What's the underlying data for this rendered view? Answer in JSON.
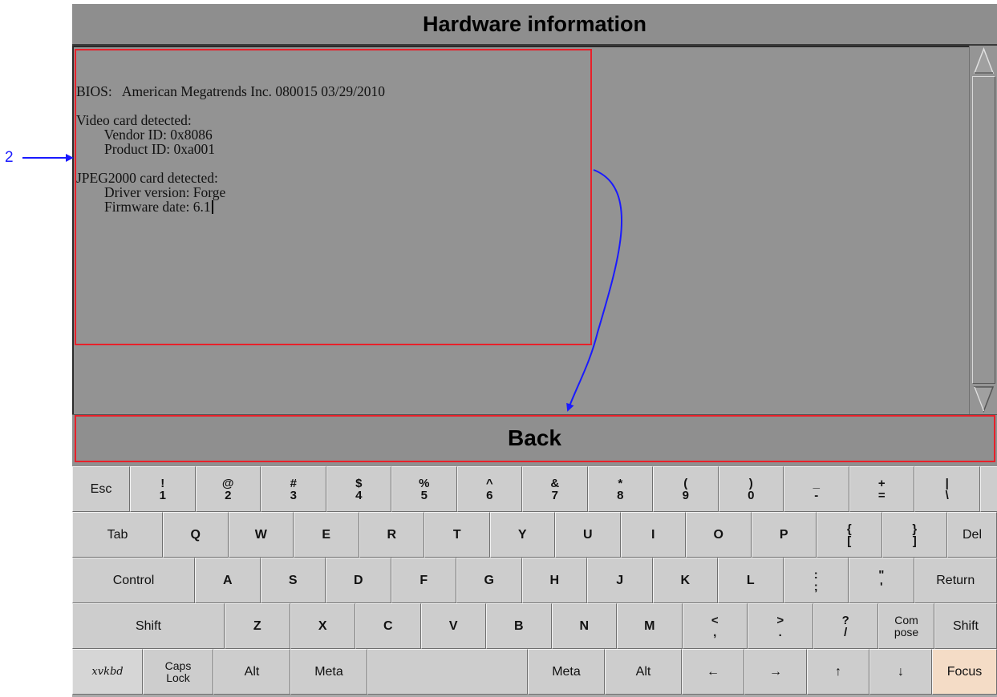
{
  "window": {
    "title": "Hardware information",
    "back_label": "Back"
  },
  "info_lines": [
    "BIOS:   American Megatrends Inc. 080015 03/29/2010",
    "",
    "Video card detected:",
    "        Vendor ID: 0x8086",
    "        Product ID: 0xa001",
    "",
    "JPEG2000 card detected:",
    "        Driver version: Forge",
    "        Firmware date: 6.1"
  ],
  "annotation": {
    "callout_number": "2",
    "highlight_color": "#e8202a",
    "arrow_color": "#1a1aff"
  },
  "keyboard": {
    "logo": "xvkbd",
    "row1": {
      "esc": "Esc",
      "keys": [
        {
          "top": "!",
          "bottom": "1"
        },
        {
          "top": "@",
          "bottom": "2"
        },
        {
          "top": "#",
          "bottom": "3"
        },
        {
          "top": "$",
          "bottom": "4"
        },
        {
          "top": "%",
          "bottom": "5"
        },
        {
          "top": "^",
          "bottom": "6"
        },
        {
          "top": "&",
          "bottom": "7"
        },
        {
          "top": "*",
          "bottom": "8"
        },
        {
          "top": "(",
          "bottom": "9"
        },
        {
          "top": ")",
          "bottom": "0"
        },
        {
          "top": "_",
          "bottom": "-"
        },
        {
          "top": "+",
          "bottom": "="
        },
        {
          "top": "|",
          "bottom": "\\"
        },
        {
          "top": "~",
          "bottom": "`"
        }
      ]
    },
    "row2": {
      "tab": "Tab",
      "letters": [
        "Q",
        "W",
        "E",
        "R",
        "T",
        "Y",
        "U",
        "I",
        "O",
        "P"
      ],
      "brackets": [
        {
          "top": "{",
          "bottom": "["
        },
        {
          "top": "}",
          "bottom": "]"
        }
      ],
      "del": "Del"
    },
    "row3": {
      "control": "Control",
      "letters": [
        "A",
        "S",
        "D",
        "F",
        "G",
        "H",
        "J",
        "K",
        "L"
      ],
      "punct": [
        {
          "top": ":",
          "bottom": ";"
        },
        {
          "top": "\"",
          "bottom": "'"
        }
      ],
      "return": "Return"
    },
    "row4": {
      "shift_left": "Shift",
      "letters": [
        "Z",
        "X",
        "C",
        "V",
        "B",
        "N",
        "M"
      ],
      "punct": [
        {
          "top": "<",
          "bottom": ","
        },
        {
          "top": ">",
          "bottom": "."
        },
        {
          "top": "?",
          "bottom": "/"
        }
      ],
      "compose": [
        "Com",
        "pose"
      ],
      "shift_right": "Shift"
    },
    "row5": {
      "caps": [
        "Caps",
        "Lock"
      ],
      "alt_left": "Alt",
      "meta_left": "Meta",
      "space": "",
      "meta_right": "Meta",
      "alt_right": "Alt",
      "arrow_left": "←",
      "arrow_right": "→",
      "arrow_up": "↑",
      "arrow_down": "↓",
      "focus": "Focus"
    }
  }
}
